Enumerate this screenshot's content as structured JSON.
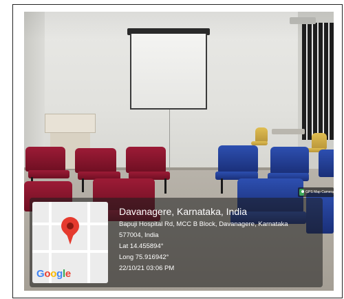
{
  "gps": {
    "location_title": "Davanagere, Karnataka, India",
    "address_line1": "Bapuji Hospital Rd, MCC B Block, Davanagere, Karnataka",
    "address_line2": "577004, India",
    "latitude": "Lat 14.455894°",
    "longitude": "Long 75.916942°",
    "datetime": "22/10/21 03:06 PM",
    "map_logo": "Google",
    "camera_badge": "GPS Map Camera"
  },
  "icons": [
    "map-pin-icon",
    "gps-camera-icon"
  ],
  "colors": {
    "pin": "#e53a2e",
    "chair_red": "#9c1b36",
    "chair_blue": "#2d4fb0",
    "overlay": "#1e1e1e"
  }
}
